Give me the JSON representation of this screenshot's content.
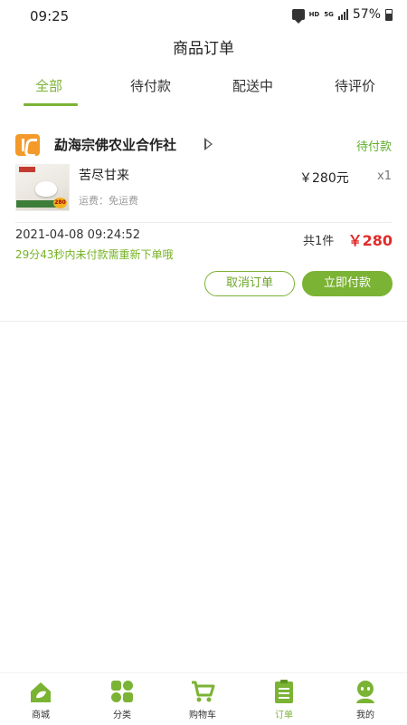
{
  "status_bar": {
    "time": "09:25",
    "network_hd": "HD",
    "network_5g": "5G",
    "battery": "57%"
  },
  "header": {
    "title": "商品订单"
  },
  "tabs": [
    {
      "label": "全部",
      "active": true
    },
    {
      "label": "待付款",
      "active": false
    },
    {
      "label": "配送中",
      "active": false
    },
    {
      "label": "待评价",
      "active": false
    }
  ],
  "order": {
    "shop_name": "勐海宗佛农业合作社",
    "status": "待付款",
    "product": {
      "name": "苦尽甘来",
      "shipping_label": "运费：",
      "shipping_value": "免运费",
      "price": "￥280元",
      "quantity": "x1",
      "thumb_badge": "280"
    },
    "created_time": "2021-04-08 09:24:52",
    "countdown_text": "29分43秒内未付款需重新下单哦",
    "item_count": "共1件",
    "total": "￥280",
    "actions": {
      "cancel_label": "取消订单",
      "pay_label": "立即付款"
    }
  },
  "bottom_nav": [
    {
      "label": "商城",
      "icon": "home-leaf-icon",
      "active": false
    },
    {
      "label": "分类",
      "icon": "category-grid-icon",
      "active": false
    },
    {
      "label": "购物车",
      "icon": "cart-icon",
      "active": false
    },
    {
      "label": "订单",
      "icon": "clipboard-icon",
      "active": true
    },
    {
      "label": "我的",
      "icon": "profile-icon",
      "active": false
    }
  ],
  "colors": {
    "accent": "#7bb334",
    "price_red": "#e12a2a",
    "shop_logo": "#f39a2a"
  }
}
